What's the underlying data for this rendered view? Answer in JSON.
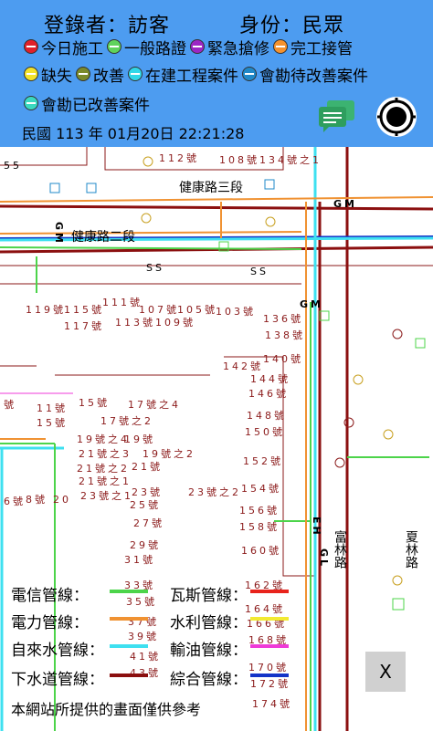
{
  "header": {
    "login_label": "登錄者：訪客",
    "role_label": "身份：民眾",
    "legend_row1": [
      {
        "label": "今日施工",
        "color": "#e0202a",
        "icon": "red-status-icon"
      },
      {
        "label": "一般路證",
        "color": "#5fd35c",
        "icon": "green-status-icon"
      },
      {
        "label": "緊急搶修",
        "color": "#9b27c4",
        "icon": "purple-status-icon"
      },
      {
        "label": "完工接管",
        "color": "#f5922e",
        "icon": "orange-status-icon"
      }
    ],
    "legend_row2": [
      {
        "label": "缺失",
        "color": "#f2e22a",
        "icon": "yellow-status-icon"
      },
      {
        "label": "改善",
        "color": "#7a8a2a",
        "icon": "olive-status-icon"
      },
      {
        "label": "在建工程案件",
        "color": "#30d7e8",
        "icon": "cyan-status-icon"
      },
      {
        "label": "會勘待改善案件",
        "color": "#1f88c8",
        "icon": "blue-status-icon"
      }
    ],
    "legend_row3": [
      {
        "label": "會勘已改善案件",
        "color": "#3ad9c0",
        "icon": "teal-status-icon"
      }
    ],
    "datetime": "民國 113 年 01月20日 22:21:28",
    "chat_icon": "chat-icon",
    "locate_icon": "locate-icon"
  },
  "map": {
    "roads": [
      "健康路三段",
      "健康路二段",
      "富林路",
      "夏林路"
    ],
    "markers": [
      "GM",
      "GM",
      "GM",
      "EH",
      "GL",
      "SS",
      "SS",
      "55"
    ],
    "addresses": {
      "top": [
        "112號",
        "108號",
        "134號之1"
      ],
      "row1": [
        "119號",
        "115號",
        "111號",
        "107號",
        "105號",
        "103號"
      ],
      "row1b": [
        "117號",
        "113號",
        "109號"
      ],
      "right": [
        "136號",
        "138號",
        "140號",
        "142號",
        "144號",
        "146號",
        "148號",
        "150號",
        "152號",
        "154號",
        "156號",
        "158號",
        "160號",
        "162號",
        "164號",
        "166號",
        "168號",
        "170號",
        "172號",
        "174號"
      ],
      "block": [
        "15號",
        "17號之4",
        "17號之2",
        "19號之4",
        "19號",
        "19號之2",
        "21號之2",
        "21號",
        "23號",
        "25號",
        "27號",
        "29號",
        "31號",
        "33號",
        "35號",
        "37號",
        "39號",
        "41號",
        "43號",
        "23號之2"
      ],
      "left": [
        "號",
        "11號",
        "15號",
        "21號之3",
        "21號之1",
        "23號之1",
        "6號",
        "8號",
        "20"
      ]
    }
  },
  "pipe_legend": [
    {
      "label": "電信管線：",
      "color": "#4cd44a"
    },
    {
      "label": "瓦斯管線：",
      "color": "#e8231c"
    },
    {
      "label": "電力管線：",
      "color": "#f09232"
    },
    {
      "label": "水利管線：",
      "color": "#f2ea32"
    },
    {
      "label": "自來水管線：",
      "color": "#3ee0f0"
    },
    {
      "label": "輸油管線：",
      "color": "#ef3ad8"
    },
    {
      "label": "下水道管線：",
      "color": "#8b0f0f"
    },
    {
      "label": "綜合管線：",
      "color": "#1434c8"
    }
  ],
  "disclaimer": "本網站所提供的畫面僅供參考",
  "close_label": "X"
}
